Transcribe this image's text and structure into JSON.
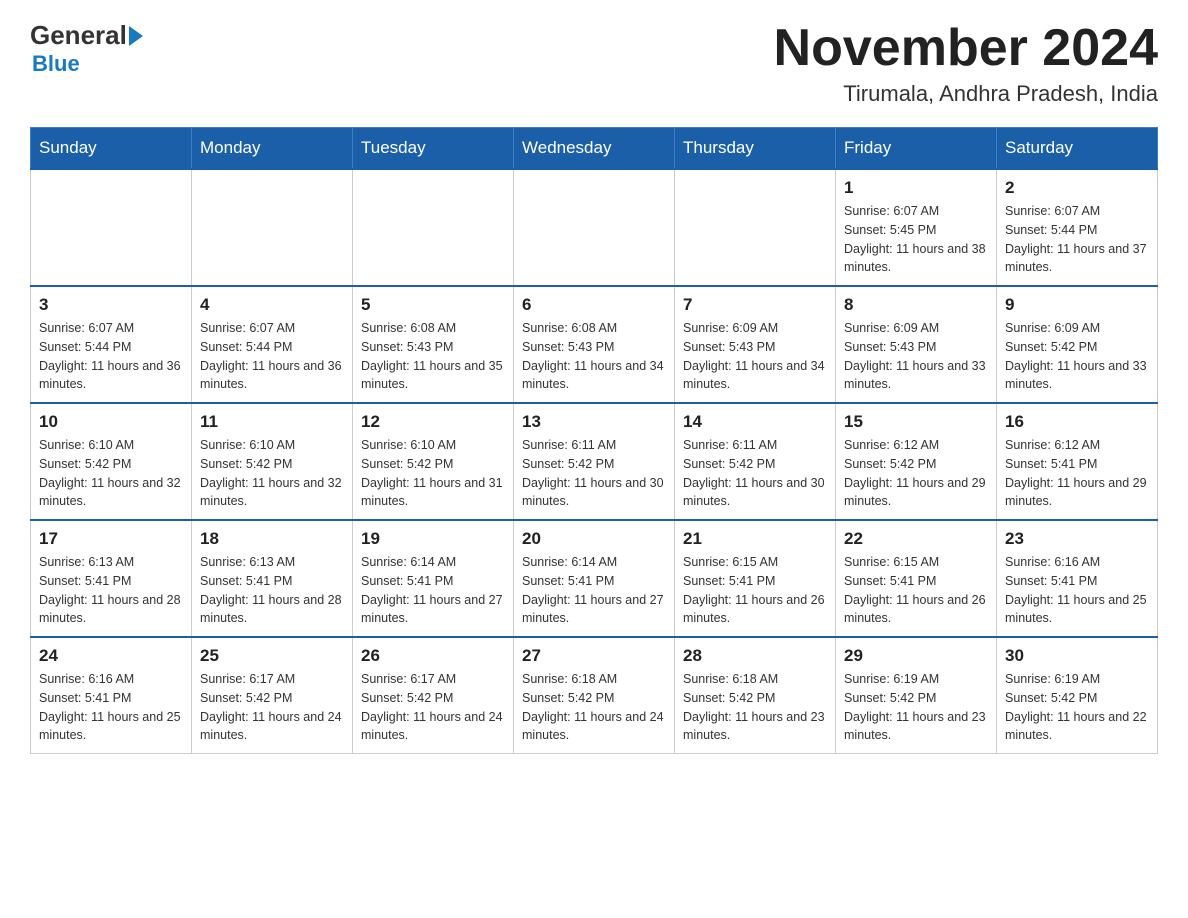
{
  "header": {
    "logo_general": "General",
    "logo_blue": "Blue",
    "month_title": "November 2024",
    "location": "Tirumala, Andhra Pradesh, India"
  },
  "days_of_week": [
    "Sunday",
    "Monday",
    "Tuesday",
    "Wednesday",
    "Thursday",
    "Friday",
    "Saturday"
  ],
  "weeks": [
    [
      {
        "day": "",
        "sunrise": "",
        "sunset": "",
        "daylight": ""
      },
      {
        "day": "",
        "sunrise": "",
        "sunset": "",
        "daylight": ""
      },
      {
        "day": "",
        "sunrise": "",
        "sunset": "",
        "daylight": ""
      },
      {
        "day": "",
        "sunrise": "",
        "sunset": "",
        "daylight": ""
      },
      {
        "day": "",
        "sunrise": "",
        "sunset": "",
        "daylight": ""
      },
      {
        "day": "1",
        "sunrise": "Sunrise: 6:07 AM",
        "sunset": "Sunset: 5:45 PM",
        "daylight": "Daylight: 11 hours and 38 minutes."
      },
      {
        "day": "2",
        "sunrise": "Sunrise: 6:07 AM",
        "sunset": "Sunset: 5:44 PM",
        "daylight": "Daylight: 11 hours and 37 minutes."
      }
    ],
    [
      {
        "day": "3",
        "sunrise": "Sunrise: 6:07 AM",
        "sunset": "Sunset: 5:44 PM",
        "daylight": "Daylight: 11 hours and 36 minutes."
      },
      {
        "day": "4",
        "sunrise": "Sunrise: 6:07 AM",
        "sunset": "Sunset: 5:44 PM",
        "daylight": "Daylight: 11 hours and 36 minutes."
      },
      {
        "day": "5",
        "sunrise": "Sunrise: 6:08 AM",
        "sunset": "Sunset: 5:43 PM",
        "daylight": "Daylight: 11 hours and 35 minutes."
      },
      {
        "day": "6",
        "sunrise": "Sunrise: 6:08 AM",
        "sunset": "Sunset: 5:43 PM",
        "daylight": "Daylight: 11 hours and 34 minutes."
      },
      {
        "day": "7",
        "sunrise": "Sunrise: 6:09 AM",
        "sunset": "Sunset: 5:43 PM",
        "daylight": "Daylight: 11 hours and 34 minutes."
      },
      {
        "day": "8",
        "sunrise": "Sunrise: 6:09 AM",
        "sunset": "Sunset: 5:43 PM",
        "daylight": "Daylight: 11 hours and 33 minutes."
      },
      {
        "day": "9",
        "sunrise": "Sunrise: 6:09 AM",
        "sunset": "Sunset: 5:42 PM",
        "daylight": "Daylight: 11 hours and 33 minutes."
      }
    ],
    [
      {
        "day": "10",
        "sunrise": "Sunrise: 6:10 AM",
        "sunset": "Sunset: 5:42 PM",
        "daylight": "Daylight: 11 hours and 32 minutes."
      },
      {
        "day": "11",
        "sunrise": "Sunrise: 6:10 AM",
        "sunset": "Sunset: 5:42 PM",
        "daylight": "Daylight: 11 hours and 32 minutes."
      },
      {
        "day": "12",
        "sunrise": "Sunrise: 6:10 AM",
        "sunset": "Sunset: 5:42 PM",
        "daylight": "Daylight: 11 hours and 31 minutes."
      },
      {
        "day": "13",
        "sunrise": "Sunrise: 6:11 AM",
        "sunset": "Sunset: 5:42 PM",
        "daylight": "Daylight: 11 hours and 30 minutes."
      },
      {
        "day": "14",
        "sunrise": "Sunrise: 6:11 AM",
        "sunset": "Sunset: 5:42 PM",
        "daylight": "Daylight: 11 hours and 30 minutes."
      },
      {
        "day": "15",
        "sunrise": "Sunrise: 6:12 AM",
        "sunset": "Sunset: 5:42 PM",
        "daylight": "Daylight: 11 hours and 29 minutes."
      },
      {
        "day": "16",
        "sunrise": "Sunrise: 6:12 AM",
        "sunset": "Sunset: 5:41 PM",
        "daylight": "Daylight: 11 hours and 29 minutes."
      }
    ],
    [
      {
        "day": "17",
        "sunrise": "Sunrise: 6:13 AM",
        "sunset": "Sunset: 5:41 PM",
        "daylight": "Daylight: 11 hours and 28 minutes."
      },
      {
        "day": "18",
        "sunrise": "Sunrise: 6:13 AM",
        "sunset": "Sunset: 5:41 PM",
        "daylight": "Daylight: 11 hours and 28 minutes."
      },
      {
        "day": "19",
        "sunrise": "Sunrise: 6:14 AM",
        "sunset": "Sunset: 5:41 PM",
        "daylight": "Daylight: 11 hours and 27 minutes."
      },
      {
        "day": "20",
        "sunrise": "Sunrise: 6:14 AM",
        "sunset": "Sunset: 5:41 PM",
        "daylight": "Daylight: 11 hours and 27 minutes."
      },
      {
        "day": "21",
        "sunrise": "Sunrise: 6:15 AM",
        "sunset": "Sunset: 5:41 PM",
        "daylight": "Daylight: 11 hours and 26 minutes."
      },
      {
        "day": "22",
        "sunrise": "Sunrise: 6:15 AM",
        "sunset": "Sunset: 5:41 PM",
        "daylight": "Daylight: 11 hours and 26 minutes."
      },
      {
        "day": "23",
        "sunrise": "Sunrise: 6:16 AM",
        "sunset": "Sunset: 5:41 PM",
        "daylight": "Daylight: 11 hours and 25 minutes."
      }
    ],
    [
      {
        "day": "24",
        "sunrise": "Sunrise: 6:16 AM",
        "sunset": "Sunset: 5:41 PM",
        "daylight": "Daylight: 11 hours and 25 minutes."
      },
      {
        "day": "25",
        "sunrise": "Sunrise: 6:17 AM",
        "sunset": "Sunset: 5:42 PM",
        "daylight": "Daylight: 11 hours and 24 minutes."
      },
      {
        "day": "26",
        "sunrise": "Sunrise: 6:17 AM",
        "sunset": "Sunset: 5:42 PM",
        "daylight": "Daylight: 11 hours and 24 minutes."
      },
      {
        "day": "27",
        "sunrise": "Sunrise: 6:18 AM",
        "sunset": "Sunset: 5:42 PM",
        "daylight": "Daylight: 11 hours and 24 minutes."
      },
      {
        "day": "28",
        "sunrise": "Sunrise: 6:18 AM",
        "sunset": "Sunset: 5:42 PM",
        "daylight": "Daylight: 11 hours and 23 minutes."
      },
      {
        "day": "29",
        "sunrise": "Sunrise: 6:19 AM",
        "sunset": "Sunset: 5:42 PM",
        "daylight": "Daylight: 11 hours and 23 minutes."
      },
      {
        "day": "30",
        "sunrise": "Sunrise: 6:19 AM",
        "sunset": "Sunset: 5:42 PM",
        "daylight": "Daylight: 11 hours and 22 minutes."
      }
    ]
  ]
}
